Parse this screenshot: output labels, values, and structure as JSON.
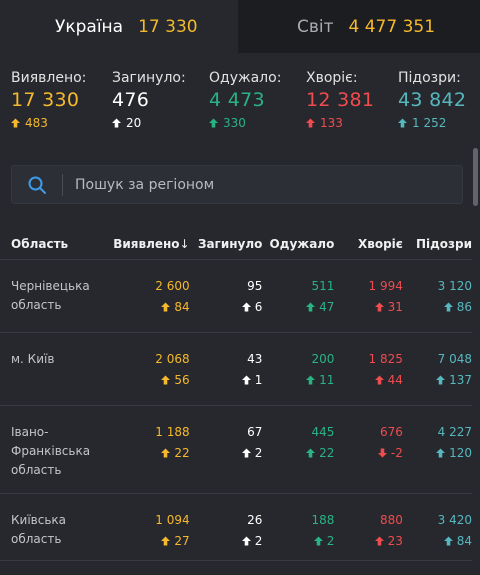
{
  "tabs": [
    {
      "name": "Україна",
      "count": "17 330"
    },
    {
      "name": "Світ",
      "count": "4 477 351"
    }
  ],
  "stats": [
    {
      "label": "Виявлено:",
      "value": "17 330",
      "delta": "483",
      "color": "yellow"
    },
    {
      "label": "Загинуло:",
      "value": "476",
      "delta": "20",
      "color": "white"
    },
    {
      "label": "Одужало:",
      "value": "4 473",
      "delta": "330",
      "color": "green"
    },
    {
      "label": "Хворіє:",
      "value": "12 381",
      "delta": "133",
      "color": "red"
    },
    {
      "label": "Підозри:",
      "value": "43 842",
      "delta": "1 252",
      "color": "teal"
    }
  ],
  "search": {
    "placeholder": "Пошук за регіоном"
  },
  "table": {
    "headers": {
      "region": "Область",
      "detected": "Виявлено",
      "detected_sort": "↓",
      "died": "Загинуло",
      "recovered": "Одужало",
      "sick": "Хворіє",
      "suspected": "Підозри"
    },
    "rows": [
      {
        "region": "Чернівецька область",
        "detected": "2 600",
        "detected_d": "84",
        "died": "95",
        "died_d": "6",
        "recovered": "511",
        "recovered_d": "47",
        "sick": "1 994",
        "sick_d": "31",
        "suspected": "3 120",
        "suspected_d": "86"
      },
      {
        "region": "м. Київ",
        "detected": "2 068",
        "detected_d": "56",
        "died": "43",
        "died_d": "1",
        "recovered": "200",
        "recovered_d": "11",
        "sick": "1 825",
        "sick_d": "44",
        "suspected": "7 048",
        "suspected_d": "137"
      },
      {
        "region": "Івано-Франківська область",
        "detected": "1 188",
        "detected_d": "22",
        "died": "67",
        "died_d": "2",
        "recovered": "445",
        "recovered_d": "22",
        "sick": "676",
        "sick_d": "-2",
        "suspected": "4 227",
        "suspected_d": "120"
      },
      {
        "region": "Київська область",
        "detected": "1 094",
        "detected_d": "27",
        "died": "26",
        "died_d": "2",
        "recovered": "188",
        "recovered_d": "2",
        "sick": "880",
        "sick_d": "23",
        "suspected": "3 420",
        "suspected_d": "84"
      }
    ]
  },
  "colors": {
    "yellow": "#f6b92d",
    "white": "#ffffff",
    "green": "#29b384",
    "red": "#f04b4e",
    "teal": "#56b8be",
    "background": "#26282d"
  }
}
